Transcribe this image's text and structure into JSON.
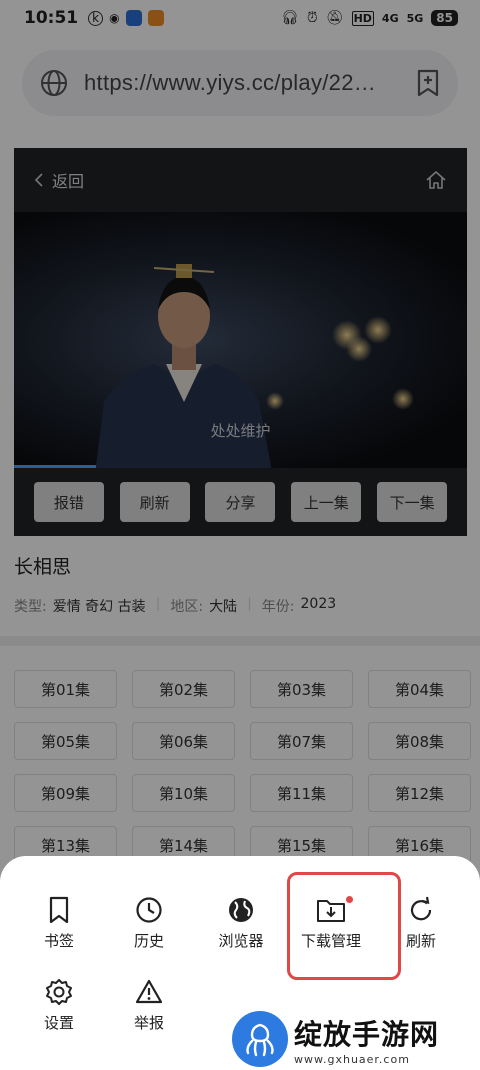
{
  "status_bar": {
    "time": "10:51",
    "battery": "85",
    "network_labels": [
      "HD",
      "4G",
      "5G"
    ]
  },
  "address_bar": {
    "url": "https://www.yiys.cc/play/22…"
  },
  "player": {
    "back_label": "返回",
    "overlay_caption": "处处维护",
    "progress_fraction": 0.18,
    "controls": [
      "报错",
      "刷新",
      "分享",
      "上一集",
      "下一集"
    ]
  },
  "show": {
    "title": "长相思",
    "type_label": "类型:",
    "type_values": "爱情 奇幻 古装",
    "region_label": "地区:",
    "region_value": "大陆",
    "year_label": "年份:",
    "year_value": "2023"
  },
  "episodes": [
    "第01集",
    "第02集",
    "第03集",
    "第04集",
    "第05集",
    "第06集",
    "第07集",
    "第08集",
    "第09集",
    "第10集",
    "第11集",
    "第12集",
    "第13集",
    "第14集",
    "第15集",
    "第16集"
  ],
  "menu": {
    "row1": [
      {
        "label": "书签",
        "icon": "bookmark-icon"
      },
      {
        "label": "历史",
        "icon": "clock-icon"
      },
      {
        "label": "浏览器",
        "icon": "globe-icon"
      },
      {
        "label": "下载管理",
        "icon": "download-folder-icon"
      },
      {
        "label": "刷新",
        "icon": "refresh-icon"
      }
    ],
    "row2": [
      {
        "label": "设置",
        "icon": "gear-icon"
      },
      {
        "label": "举报",
        "icon": "warning-icon"
      }
    ],
    "highlight_color": "#e04848"
  },
  "watermark": {
    "name": "绽放手游网",
    "domain": "www.gxhuaer.com"
  }
}
